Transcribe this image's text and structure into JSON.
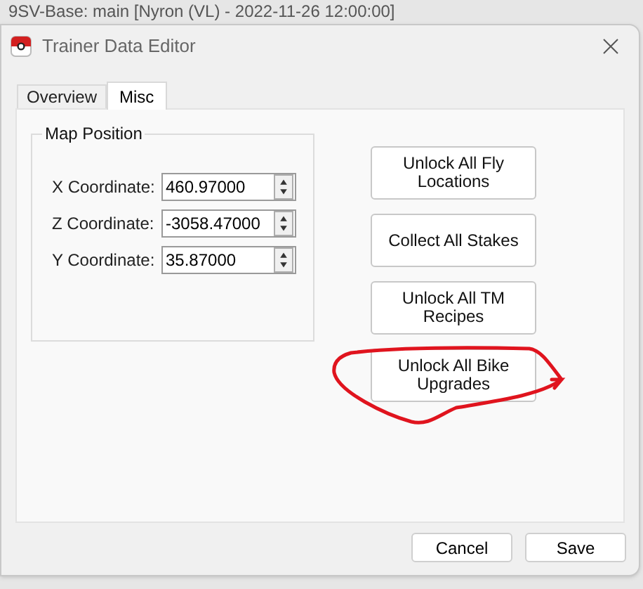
{
  "background_window": {
    "title": "9SV-Base: main [Nyron (VL) - 2022-11-26 12:00:00]"
  },
  "dialog": {
    "title": "Trainer Data Editor"
  },
  "tabs": [
    {
      "label": "Overview",
      "selected": false
    },
    {
      "label": "Misc",
      "selected": true
    }
  ],
  "map_position": {
    "title": "Map Position",
    "fields": [
      {
        "label": "X Coordinate:",
        "value": "460.97000"
      },
      {
        "label": "Z Coordinate:",
        "value": "-3058.47000"
      },
      {
        "label": "Y Coordinate:",
        "value": "35.87000"
      }
    ]
  },
  "actions": [
    "Unlock All Fly Locations",
    "Collect All Stakes",
    "Unlock All TM Recipes",
    "Unlock All Bike Upgrades"
  ],
  "footer_buttons": [
    "Cancel",
    "Save"
  ]
}
